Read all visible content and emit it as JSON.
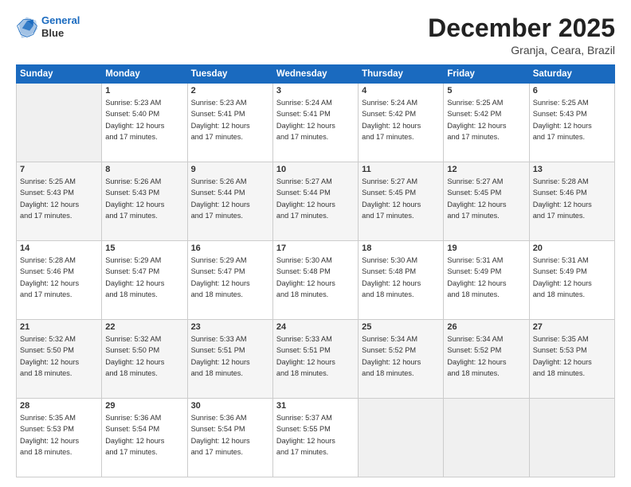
{
  "header": {
    "logo_line1": "General",
    "logo_line2": "Blue",
    "title": "December 2025",
    "subtitle": "Granja, Ceara, Brazil"
  },
  "calendar": {
    "days_of_week": [
      "Sunday",
      "Monday",
      "Tuesday",
      "Wednesday",
      "Thursday",
      "Friday",
      "Saturday"
    ],
    "weeks": [
      [
        {
          "day": "",
          "info": ""
        },
        {
          "day": "1",
          "info": "Sunrise: 5:23 AM\nSunset: 5:40 PM\nDaylight: 12 hours\nand 17 minutes."
        },
        {
          "day": "2",
          "info": "Sunrise: 5:23 AM\nSunset: 5:41 PM\nDaylight: 12 hours\nand 17 minutes."
        },
        {
          "day": "3",
          "info": "Sunrise: 5:24 AM\nSunset: 5:41 PM\nDaylight: 12 hours\nand 17 minutes."
        },
        {
          "day": "4",
          "info": "Sunrise: 5:24 AM\nSunset: 5:42 PM\nDaylight: 12 hours\nand 17 minutes."
        },
        {
          "day": "5",
          "info": "Sunrise: 5:25 AM\nSunset: 5:42 PM\nDaylight: 12 hours\nand 17 minutes."
        },
        {
          "day": "6",
          "info": "Sunrise: 5:25 AM\nSunset: 5:43 PM\nDaylight: 12 hours\nand 17 minutes."
        }
      ],
      [
        {
          "day": "7",
          "info": "Sunrise: 5:25 AM\nSunset: 5:43 PM\nDaylight: 12 hours\nand 17 minutes."
        },
        {
          "day": "8",
          "info": "Sunrise: 5:26 AM\nSunset: 5:43 PM\nDaylight: 12 hours\nand 17 minutes."
        },
        {
          "day": "9",
          "info": "Sunrise: 5:26 AM\nSunset: 5:44 PM\nDaylight: 12 hours\nand 17 minutes."
        },
        {
          "day": "10",
          "info": "Sunrise: 5:27 AM\nSunset: 5:44 PM\nDaylight: 12 hours\nand 17 minutes."
        },
        {
          "day": "11",
          "info": "Sunrise: 5:27 AM\nSunset: 5:45 PM\nDaylight: 12 hours\nand 17 minutes."
        },
        {
          "day": "12",
          "info": "Sunrise: 5:27 AM\nSunset: 5:45 PM\nDaylight: 12 hours\nand 17 minutes."
        },
        {
          "day": "13",
          "info": "Sunrise: 5:28 AM\nSunset: 5:46 PM\nDaylight: 12 hours\nand 17 minutes."
        }
      ],
      [
        {
          "day": "14",
          "info": "Sunrise: 5:28 AM\nSunset: 5:46 PM\nDaylight: 12 hours\nand 17 minutes."
        },
        {
          "day": "15",
          "info": "Sunrise: 5:29 AM\nSunset: 5:47 PM\nDaylight: 12 hours\nand 18 minutes."
        },
        {
          "day": "16",
          "info": "Sunrise: 5:29 AM\nSunset: 5:47 PM\nDaylight: 12 hours\nand 18 minutes."
        },
        {
          "day": "17",
          "info": "Sunrise: 5:30 AM\nSunset: 5:48 PM\nDaylight: 12 hours\nand 18 minutes."
        },
        {
          "day": "18",
          "info": "Sunrise: 5:30 AM\nSunset: 5:48 PM\nDaylight: 12 hours\nand 18 minutes."
        },
        {
          "day": "19",
          "info": "Sunrise: 5:31 AM\nSunset: 5:49 PM\nDaylight: 12 hours\nand 18 minutes."
        },
        {
          "day": "20",
          "info": "Sunrise: 5:31 AM\nSunset: 5:49 PM\nDaylight: 12 hours\nand 18 minutes."
        }
      ],
      [
        {
          "day": "21",
          "info": "Sunrise: 5:32 AM\nSunset: 5:50 PM\nDaylight: 12 hours\nand 18 minutes."
        },
        {
          "day": "22",
          "info": "Sunrise: 5:32 AM\nSunset: 5:50 PM\nDaylight: 12 hours\nand 18 minutes."
        },
        {
          "day": "23",
          "info": "Sunrise: 5:33 AM\nSunset: 5:51 PM\nDaylight: 12 hours\nand 18 minutes."
        },
        {
          "day": "24",
          "info": "Sunrise: 5:33 AM\nSunset: 5:51 PM\nDaylight: 12 hours\nand 18 minutes."
        },
        {
          "day": "25",
          "info": "Sunrise: 5:34 AM\nSunset: 5:52 PM\nDaylight: 12 hours\nand 18 minutes."
        },
        {
          "day": "26",
          "info": "Sunrise: 5:34 AM\nSunset: 5:52 PM\nDaylight: 12 hours\nand 18 minutes."
        },
        {
          "day": "27",
          "info": "Sunrise: 5:35 AM\nSunset: 5:53 PM\nDaylight: 12 hours\nand 18 minutes."
        }
      ],
      [
        {
          "day": "28",
          "info": "Sunrise: 5:35 AM\nSunset: 5:53 PM\nDaylight: 12 hours\nand 18 minutes."
        },
        {
          "day": "29",
          "info": "Sunrise: 5:36 AM\nSunset: 5:54 PM\nDaylight: 12 hours\nand 17 minutes."
        },
        {
          "day": "30",
          "info": "Sunrise: 5:36 AM\nSunset: 5:54 PM\nDaylight: 12 hours\nand 17 minutes."
        },
        {
          "day": "31",
          "info": "Sunrise: 5:37 AM\nSunset: 5:55 PM\nDaylight: 12 hours\nand 17 minutes."
        },
        {
          "day": "",
          "info": ""
        },
        {
          "day": "",
          "info": ""
        },
        {
          "day": "",
          "info": ""
        }
      ]
    ]
  }
}
